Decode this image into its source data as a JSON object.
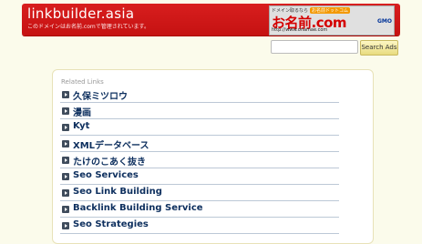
{
  "header": {
    "domain": "linkbuilder.asia",
    "subtitle": "このドメインはお名前.comで管理されています。",
    "promo": {
      "tagline": "ドメイン取るなら",
      "badge": "お名前ドットコム",
      "logo": "お名前.com",
      "gmo": "GMO",
      "url": "http://www.onamae.com"
    }
  },
  "search": {
    "placeholder": "",
    "button_label": "Search Ads"
  },
  "panel": {
    "heading": "Related Links",
    "links": [
      "久保ミツロウ",
      "漫画",
      "Kyt",
      "XMLデータベース",
      "たけのこあく抜き",
      "Seo Services",
      "Seo Link Building",
      "Backlink Building Service",
      "Seo Strategies"
    ]
  },
  "colors": {
    "header_red": "#d81e1e",
    "page_bg": "#fbfbeb",
    "link_navy": "#0d2f5e"
  }
}
